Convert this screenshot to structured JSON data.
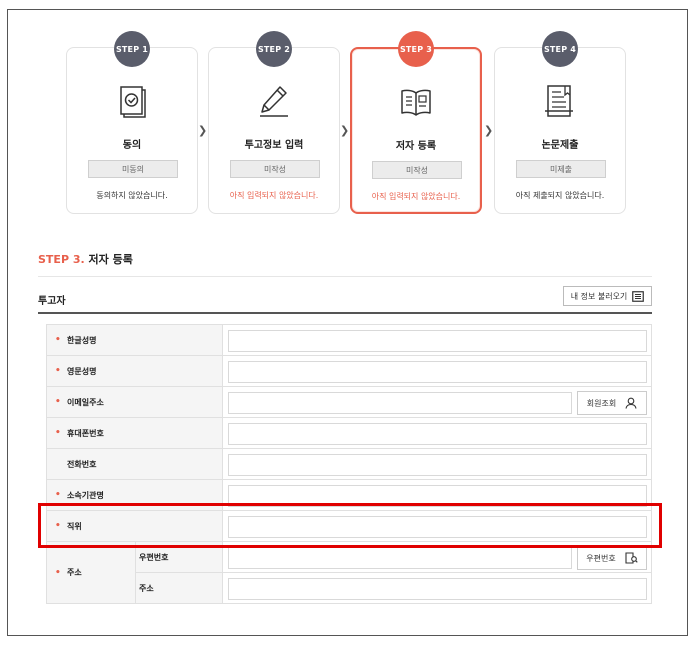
{
  "steps": [
    {
      "badge": "STEP 1",
      "title": "동의",
      "status": "미동의",
      "desc": "동의하지 않았습니다.",
      "icon": "agreement-document-icon"
    },
    {
      "badge": "STEP 2",
      "title": "투고정보 입력",
      "status": "미작성",
      "desc": "아직 입력되지 않았습니다.",
      "icon": "pencil-icon"
    },
    {
      "badge": "STEP 3",
      "title": "저자 등록",
      "status": "미작성",
      "desc": "아직 입력되지 않았습니다.",
      "icon": "open-book-icon"
    },
    {
      "badge": "STEP 4",
      "title": "논문제출",
      "status": "미제출",
      "desc": "아직 제출되지 않았습니다.",
      "icon": "paper-submit-icon"
    }
  ],
  "section": {
    "step_label": "STEP 3.",
    "title": "저자 등록"
  },
  "submitter": {
    "title": "투고자",
    "load_button": "내 정보 불러오기"
  },
  "fields": [
    {
      "label": "한글성명",
      "required": true,
      "value": ""
    },
    {
      "label": "영문성명",
      "required": true,
      "value": ""
    },
    {
      "label": "이메일주소",
      "required": true,
      "value": "",
      "button": "회원조회"
    },
    {
      "label": "휴대폰번호",
      "required": true,
      "value": ""
    },
    {
      "label": "전화번호",
      "required": false,
      "value": ""
    },
    {
      "label": "소속기관명",
      "required": true,
      "value": ""
    },
    {
      "label": "직위",
      "required": true,
      "value": ""
    }
  ],
  "address": {
    "label": "주소",
    "required": true,
    "postcode_label": "우편번호",
    "postcode_button": "우편번호",
    "address_label": "주소"
  },
  "colors": {
    "accent": "#e8604c",
    "badge": "#5a5d6b",
    "highlight": "#e00000"
  }
}
